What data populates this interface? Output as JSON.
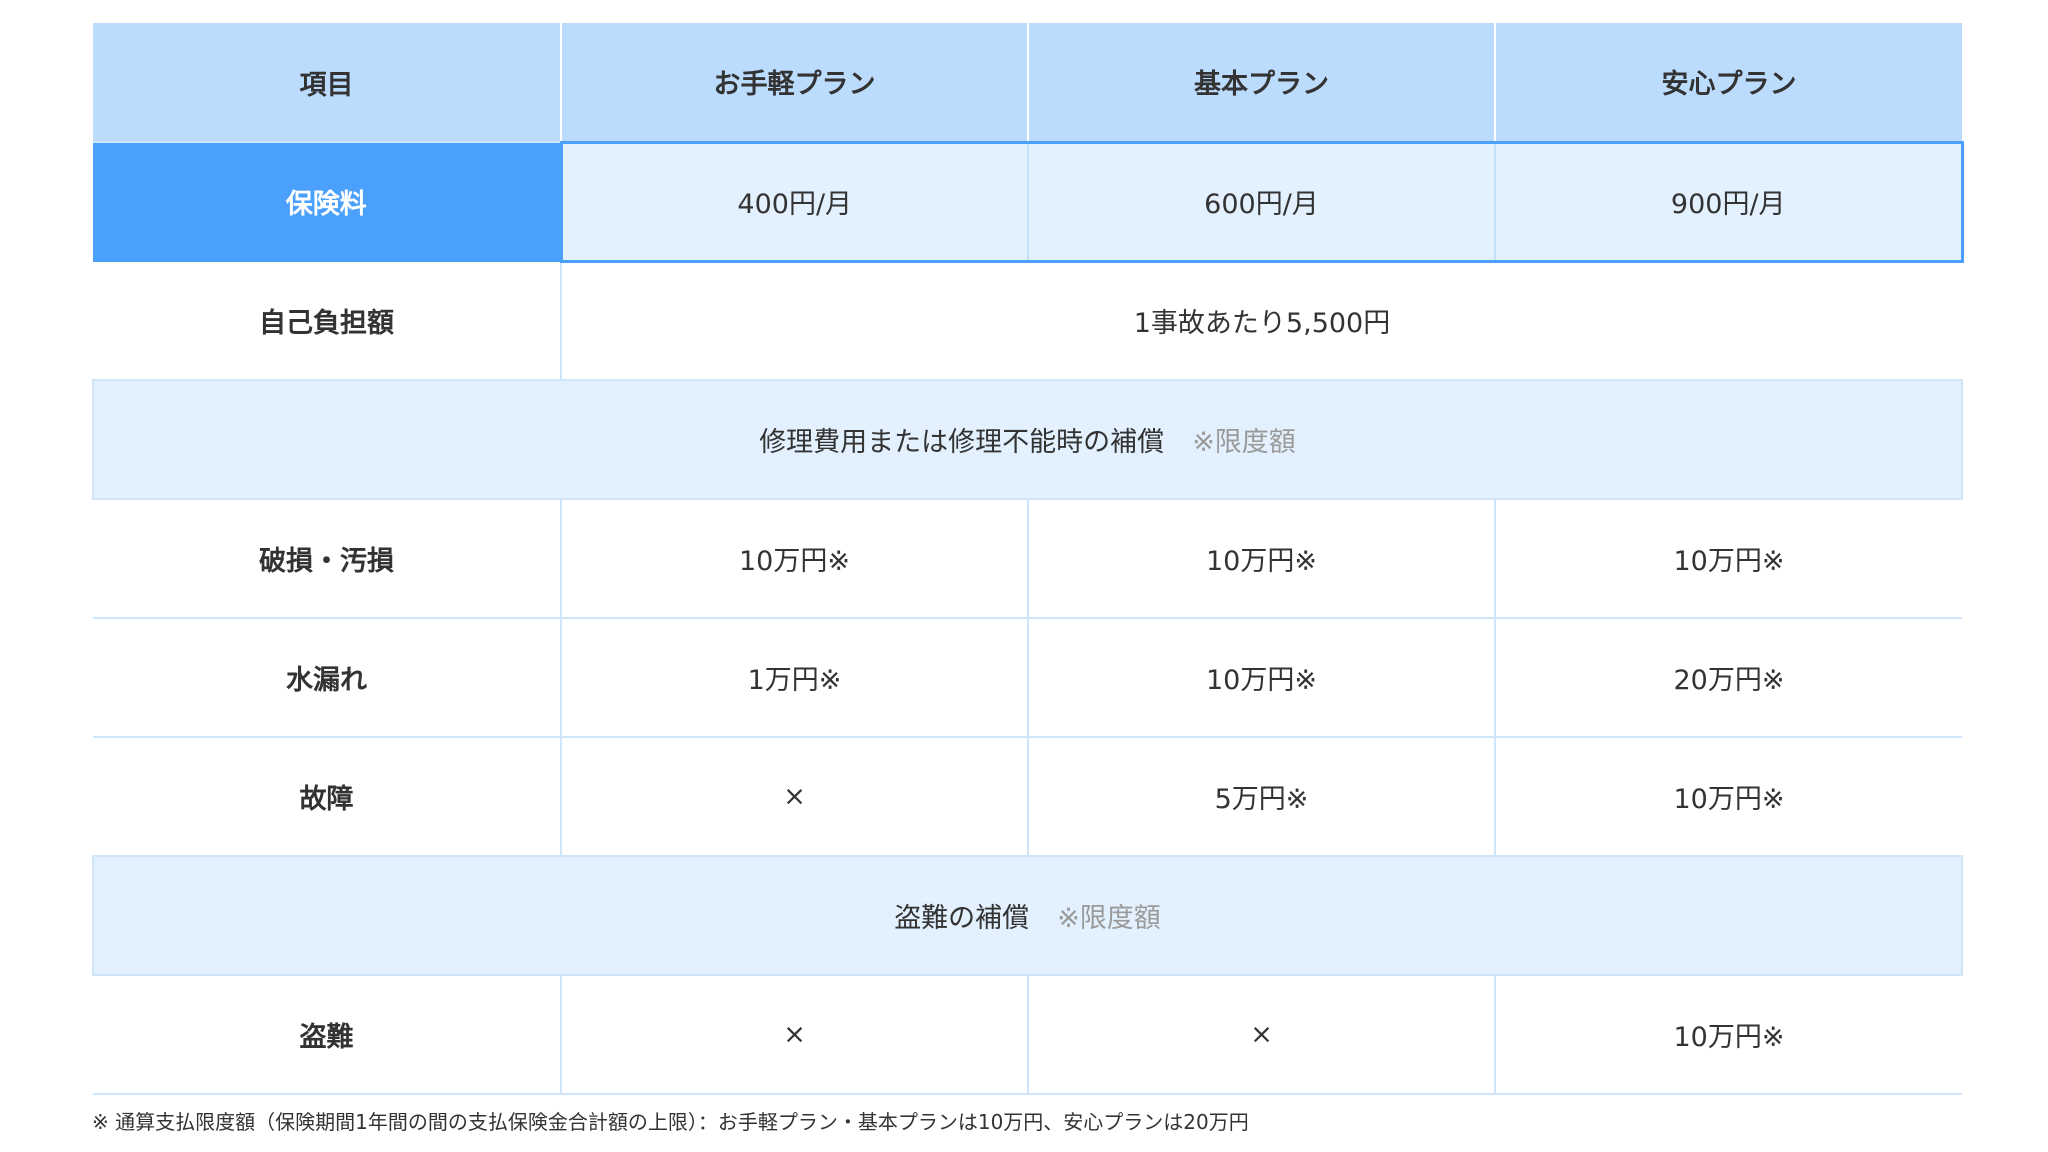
{
  "table": {
    "header": {
      "item": "項目",
      "plans": [
        "お手軽プラン",
        "基本プラン",
        "安心プラン"
      ]
    },
    "premium": {
      "label": "保険料",
      "values": [
        "400円/月",
        "600円/月",
        "900円/月"
      ]
    },
    "deductible": {
      "label": "自己負担額",
      "value": "1事故あたり5,500円"
    },
    "repair_section": {
      "title": "修理費用または修理不能時の補償",
      "note": "※限度額"
    },
    "repair_rows": [
      {
        "label": "破損・汚損",
        "values": [
          "10万円※",
          "10万円※",
          "10万円※"
        ]
      },
      {
        "label": "水漏れ",
        "values": [
          "1万円※",
          "10万円※",
          "20万円※"
        ]
      },
      {
        "label": "故障",
        "values": [
          "×",
          "5万円※",
          "10万円※"
        ]
      }
    ],
    "theft_section": {
      "title": "盗難の補償",
      "note": "※限度額"
    },
    "theft_rows": [
      {
        "label": "盗難",
        "values": [
          "×",
          "×",
          "10万円※"
        ]
      }
    ]
  },
  "footnote": "※ 通算支払限度額（保険期間1年間の間の支払保険金合計額の上限）：お手軽プラン・基本プランは10万円、安心プランは20万円",
  "colors": {
    "header_bg": "#bcdcfd",
    "accent": "#4ba0fc",
    "highlight_bg": "#e3f1fe",
    "border": "#cfe5fa",
    "note_text": "#9a9a9a"
  }
}
